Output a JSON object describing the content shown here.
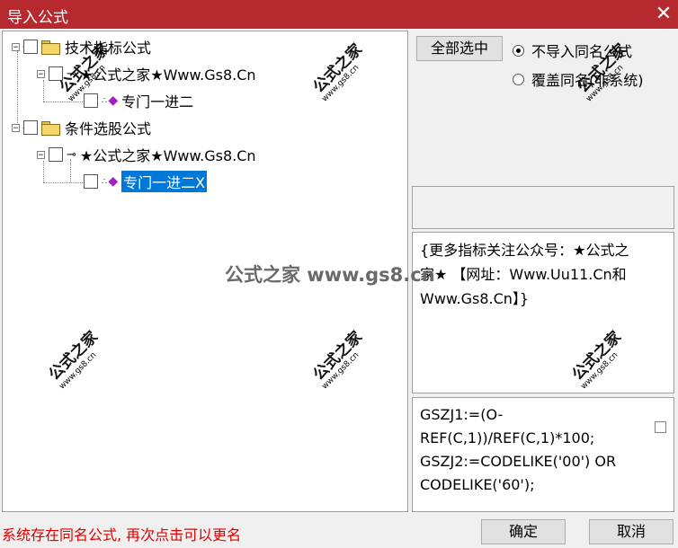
{
  "window": {
    "title": "导入公式",
    "close": "✕"
  },
  "tree": {
    "folder1": "技术指标公式",
    "author1": "★公式之家★Www.Gs8.Cn",
    "formula1": "专门一进二",
    "folder2": "条件选股公式",
    "author2": "★公式之家★Www.Gs8.Cn",
    "formula2": "专门一进二X"
  },
  "buttons": {
    "select_all": "全部选中",
    "ok": "确定",
    "cancel": "取消"
  },
  "options": {
    "no_import": "不导入同名公式",
    "overwrite": "覆盖同名(非系统)"
  },
  "description": "{更多指标关注公众号：★公式之家★ 【网址：Www.Uu11.Cn和Www.Gs8.Cn】}",
  "code": "GSZJ1:=(O-REF(C,1))/REF(C,1)*100;\nGSZJ2:=CODELIKE('00') OR CODELIKE('60');",
  "status": "系统存在同名公式, 再次点击可以更名",
  "watermark": {
    "main": "公式之家",
    "sub": "www.gs8.cn",
    "center": "公式之家 www.gs8.cn"
  }
}
